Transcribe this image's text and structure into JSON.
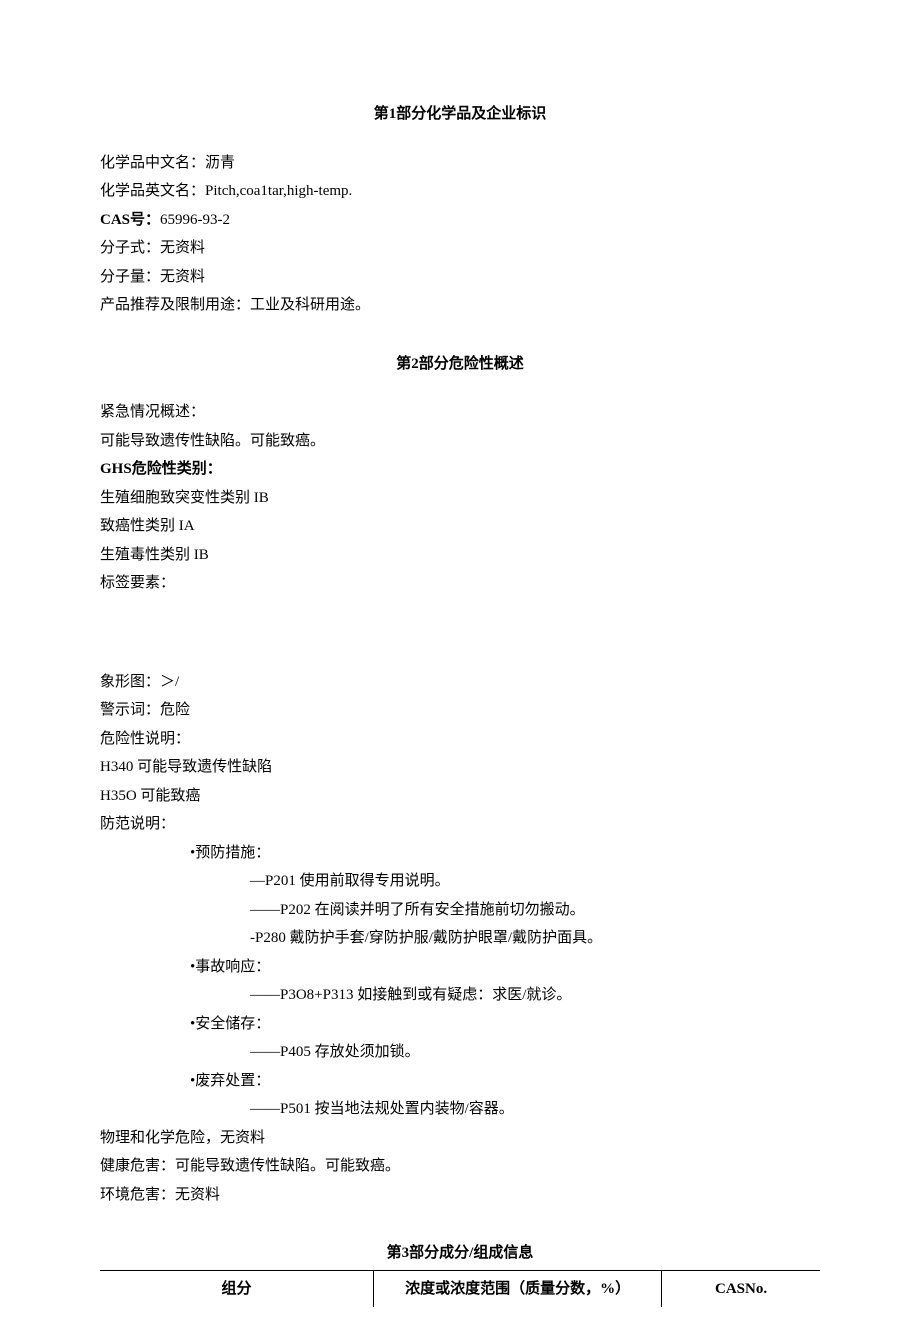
{
  "section1": {
    "title_prefix": "第",
    "title_num": "1",
    "title_suffix": "部分化学品及企业标识",
    "name_cn_label": "化学品中文名：",
    "name_cn_value": "沥青",
    "name_en_label": "化学品英文名：",
    "name_en_value": "Pitch,coa1tar,high-temp.",
    "cas_label": "CAS",
    "cas_mid": "号：",
    "cas_value": "65996-93-2",
    "formula_label": "分子式：",
    "formula_value": "无资料",
    "weight_label": "分子量：",
    "weight_value": "无资料",
    "use_label": "产品推荐及限制用途：",
    "use_value": "工业及科研用途。"
  },
  "section2": {
    "title_prefix": "第",
    "title_num": "2",
    "title_suffix": "部分危险性概述",
    "emergency_label": "紧急情况概述：",
    "emergency_value": "可能导致遗传性缺陷。可能致癌。",
    "ghs_label": "GHS",
    "ghs_suffix": "危险性类别：",
    "ghs_items": [
      "生殖细胞致突变性类别 IB",
      "致癌性类别 IA",
      "生殖毒性类别 IB"
    ],
    "label_elements": "标签要素：",
    "pictogram": "象形图：＞/",
    "signal_word": "警示词：危险",
    "hazard_label": "危险性说明：",
    "hazard_items": [
      "H340 可能导致遗传性缺陷",
      "H35O 可能致癌"
    ],
    "precaution_label": "防范说明：",
    "precaution_groups": [
      {
        "title": "•预防措施：",
        "items": [
          "—P201 使用前取得专用说明。",
          "——P202 在阅读并明了所有安全措施前切勿搬动。",
          "-P280 戴防护手套/穿防护服/戴防护眼罩/戴防护面具。"
        ]
      },
      {
        "title": "•事故响应：",
        "items": [
          "——P3O8+P313 如接触到或有疑虑：求医/就诊。"
        ]
      },
      {
        "title": "•安全储存：",
        "items": [
          "——P405 存放处须加锁。"
        ]
      },
      {
        "title": "•废弃处置：",
        "items": [
          "——P501 按当地法规处置内装物/容器。"
        ]
      }
    ],
    "physchem_label": "物理和化学危险，",
    "physchem_value": "无资料",
    "health_label": "健康危害：",
    "health_value": "可能导致遗传性缺陷。可能致癌。",
    "env_label": "环境危害：",
    "env_value": "无资料"
  },
  "section3": {
    "title_prefix": "第",
    "title_num": "3",
    "title_suffix": "部分成分/组成信息",
    "headers": [
      "组分",
      "浓度或浓度范围（质量分数，%）",
      "CASNo."
    ]
  }
}
